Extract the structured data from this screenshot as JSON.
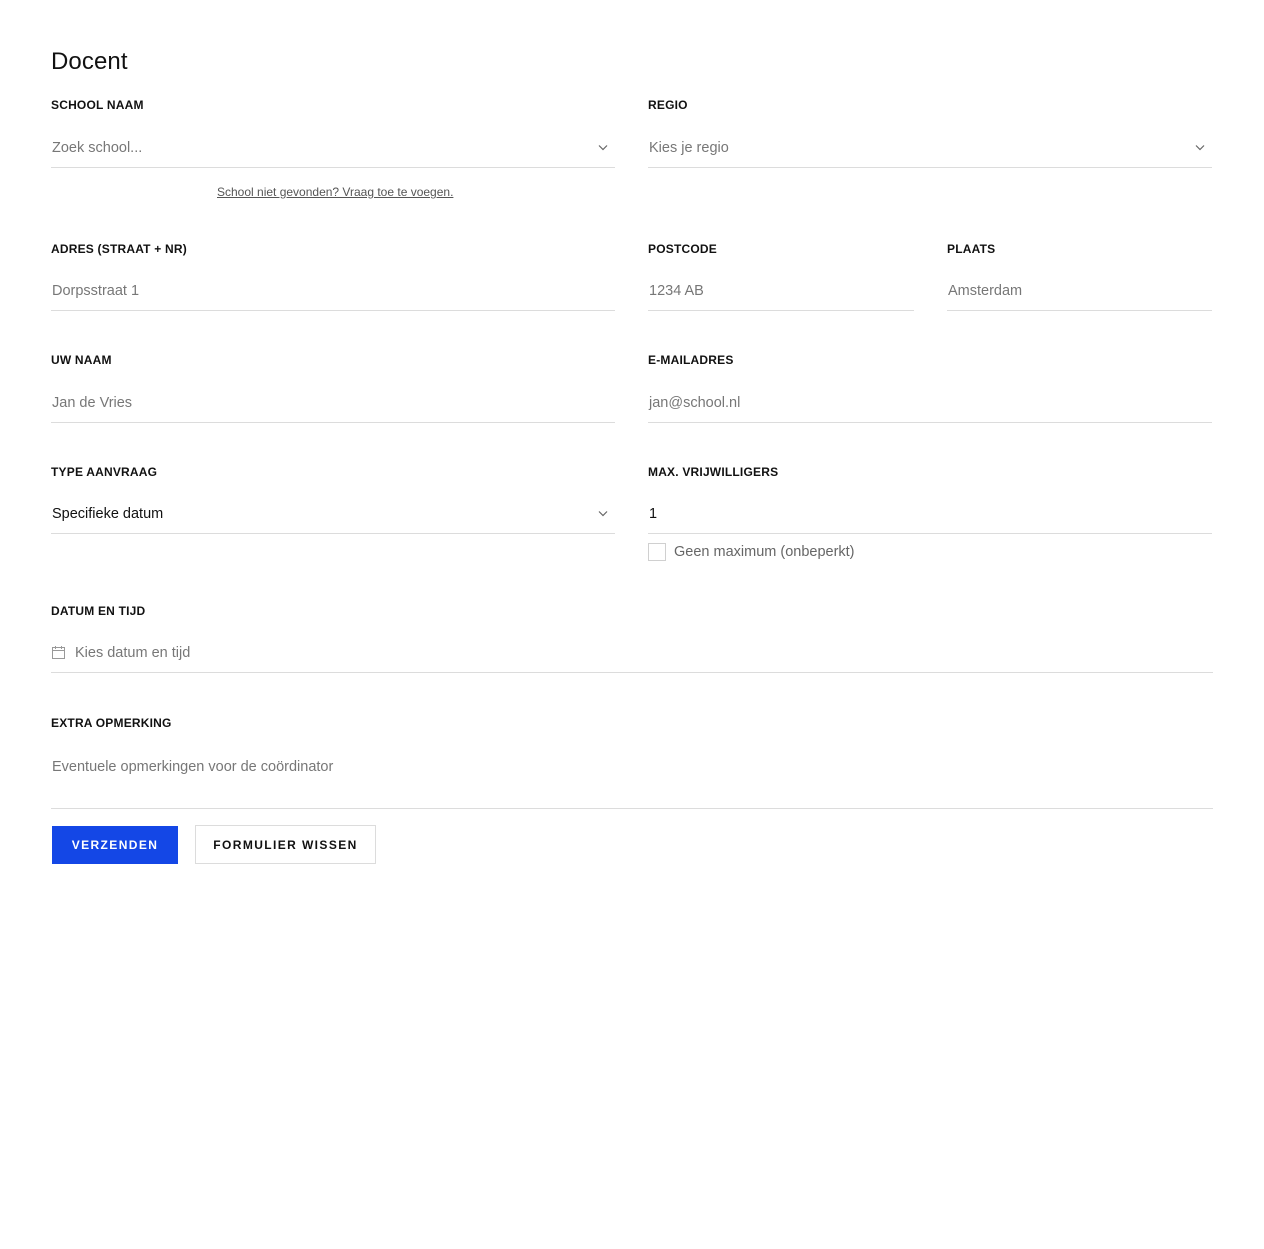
{
  "form": {
    "title": "Docent",
    "school": {
      "label": "SCHOOL NAAM",
      "placeholder": "Zoek school...",
      "help_link": "School niet gevonden? Vraag toe te voegen."
    },
    "regio": {
      "label": "REGIO",
      "placeholder": "Kies je regio"
    },
    "adres": {
      "label": "ADRES (STRAAT + NR)",
      "placeholder": "Dorpsstraat 1"
    },
    "postcode": {
      "label": "POSTCODE",
      "placeholder": "1234 AB"
    },
    "plaats": {
      "label": "PLAATS",
      "placeholder": "Amsterdam"
    },
    "naam": {
      "label": "UW NAAM",
      "placeholder": "Jan de Vries"
    },
    "email": {
      "label": "E-MAILADRES",
      "placeholder": "jan@school.nl"
    },
    "type": {
      "label": "TYPE AANVRAAG",
      "value": "Specifieke datum"
    },
    "max": {
      "label": "MAX. VRIJWILLIGERS",
      "value": "1",
      "checkbox_label": "Geen maximum (onbeperkt)",
      "checkbox_checked": false
    },
    "datum": {
      "label": "DATUM EN TIJD",
      "placeholder": "Kies datum en tijd"
    },
    "opmerking": {
      "label": "EXTRA OPMERKING",
      "placeholder": "Eventuele opmerkingen voor de coördinator"
    },
    "buttons": {
      "submit": "VERZENDEN",
      "clear": "FORMULIER WISSEN"
    }
  },
  "colors": {
    "primary": "#1447e6",
    "border": "#dcdcdc",
    "placeholder": "#777777",
    "text": "#111111"
  },
  "icons": {
    "dropdown": "chevron-down-icon",
    "date": "calendar-icon"
  }
}
